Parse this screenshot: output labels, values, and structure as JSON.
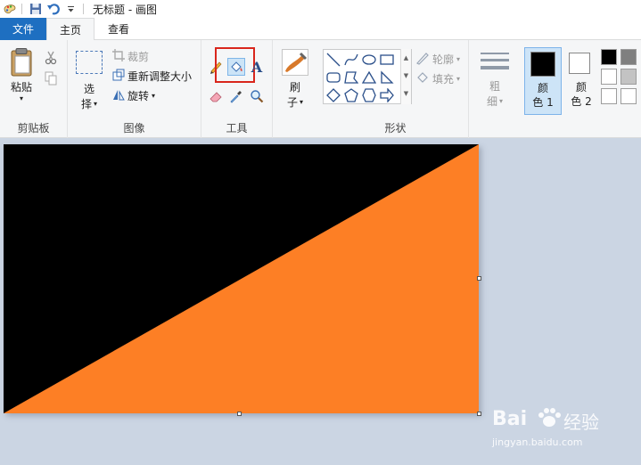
{
  "window": {
    "title": "无标题 - 画图"
  },
  "tabs": {
    "file": "文件",
    "home": "主页",
    "view": "查看"
  },
  "clipboard": {
    "paste": "粘贴",
    "group_label": "剪贴板"
  },
  "image": {
    "select_line1": "选",
    "select_line2": "择",
    "crop": "裁剪",
    "resize": "重新调整大小",
    "rotate": "旋转",
    "group_label": "图像"
  },
  "tools": {
    "group_label": "工具",
    "selected_tool": "fill-bucket-icon",
    "text_tool_glyph": "A"
  },
  "brushes": {
    "line1": "刷",
    "line2": "子"
  },
  "shapes": {
    "outline": "轮廓",
    "fill": "填充",
    "group_label": "形状"
  },
  "size": {
    "line1": "粗",
    "line2": "细"
  },
  "colors": {
    "color1_line1": "颜",
    "color1_line2": "色 1",
    "color2_line1": "颜",
    "color2_line2": "色 2",
    "color1_value": "#000000",
    "color2_value": "#ffffff",
    "palette": [
      "#000000",
      "#7f7f7f",
      "#ffffff",
      "#c3c3c3",
      "#ffffff",
      "#ffffff"
    ]
  },
  "canvas": {
    "top_left_color": "#000000",
    "bottom_right_color": "#fd7f25"
  },
  "watermark": {
    "brand": "Bai",
    "brand_suffix": "经验",
    "url": "jingyan.baidu.com"
  }
}
